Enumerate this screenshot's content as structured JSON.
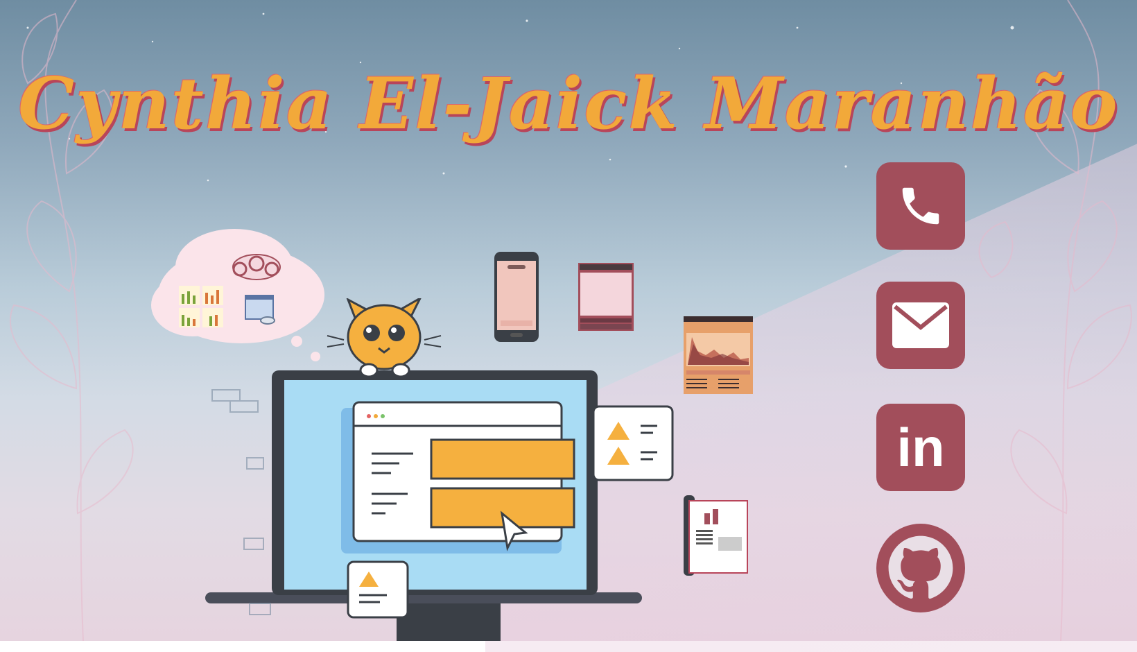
{
  "page": {
    "title": "Cynthia El-Jaick Maranhão"
  },
  "social": [
    {
      "name": "phone",
      "icon": "phone-icon"
    },
    {
      "name": "email",
      "icon": "envelope-icon"
    },
    {
      "name": "linkedin",
      "icon": "linkedin-icon",
      "label": "in"
    },
    {
      "name": "github",
      "icon": "github-icon"
    }
  ],
  "colors": {
    "accent": "#f2a93a",
    "brand": "#a24e5b",
    "shadow": "#b8455a"
  }
}
